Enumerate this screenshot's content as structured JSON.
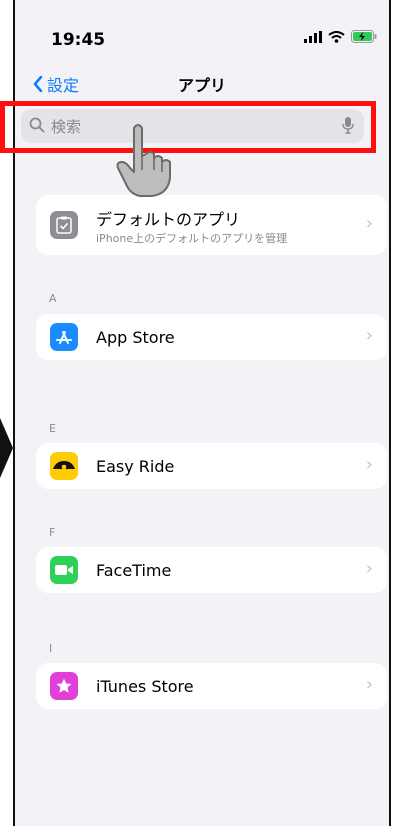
{
  "status_bar": {
    "time": "19:45"
  },
  "nav": {
    "back_label": "設定",
    "title": "アプリ"
  },
  "search": {
    "placeholder": "検索"
  },
  "default_apps": {
    "title": "デフォルトのアプリ",
    "subtitle": "iPhone上のデフォルトのアプリを管理"
  },
  "sections": [
    {
      "letter": "A",
      "app": "App Store"
    },
    {
      "letter": "E",
      "app": "Easy Ride"
    },
    {
      "letter": "F",
      "app": "FaceTime"
    },
    {
      "letter": "I",
      "app": "iTunes Store"
    }
  ],
  "colors": {
    "accent": "#0a7aff",
    "highlight_outline": "#ff1010",
    "app_store": "#1a8cff",
    "easy_ride": "#ffcc00",
    "facetime": "#2ed158",
    "itunes": "#e040d8",
    "battery": "#34c759"
  },
  "icons": {
    "back": "chevron-left-icon",
    "search": "magnifier-icon",
    "mic": "microphone-icon",
    "default_apps": "checklist-icon",
    "app_store": "app-store-icon",
    "easy_ride": "taxi-icon",
    "facetime": "video-camera-icon",
    "itunes": "star-icon",
    "pointer": "hand-pointer-icon"
  }
}
